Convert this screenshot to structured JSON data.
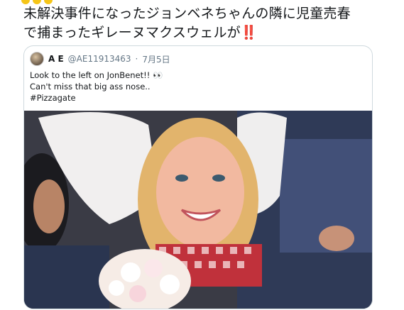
{
  "tweet": {
    "text_line1": "未解決事件になったジョンベネちゃんの隣に児童売春",
    "text_line2": "で捕まったギレーヌマクスウェルが",
    "emphasis": "‼️"
  },
  "quote": {
    "name": "A E",
    "handle": "@AE11913463",
    "separator": "·",
    "date": "7月5日",
    "lines": [
      "Look to the left on JonBenet!! 👀",
      "Can't miss that big ass nose..",
      "#Pizzagate"
    ],
    "avatar_icon": "avatar-photo"
  },
  "colors": {
    "text": "#14171a",
    "secondary": "#657786",
    "border": "#cfd9de",
    "emphasis": "#d8232a"
  }
}
